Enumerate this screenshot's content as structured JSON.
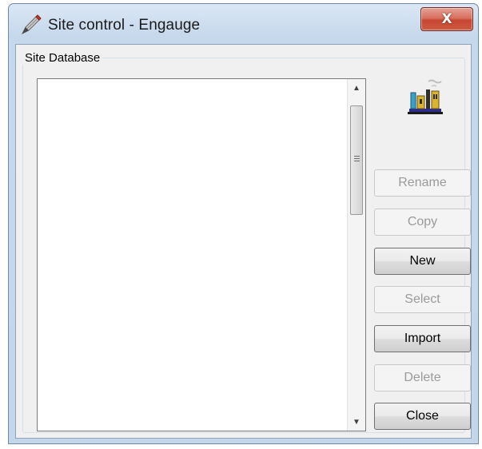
{
  "window": {
    "title": "Site control - Engauge",
    "app_icon": "pencil-icon",
    "close_glyph": "X"
  },
  "group": {
    "label": "Site Database"
  },
  "listbox": {
    "items": []
  },
  "site_icon": "factory-icon",
  "buttons": {
    "rename": "Rename",
    "copy": "Copy",
    "new": "New",
    "select": "Select",
    "import": "Import",
    "delete": "Delete",
    "close": "Close"
  },
  "colors": {
    "disabled_text": "#9a9a9a",
    "close_button": "#c74732"
  }
}
